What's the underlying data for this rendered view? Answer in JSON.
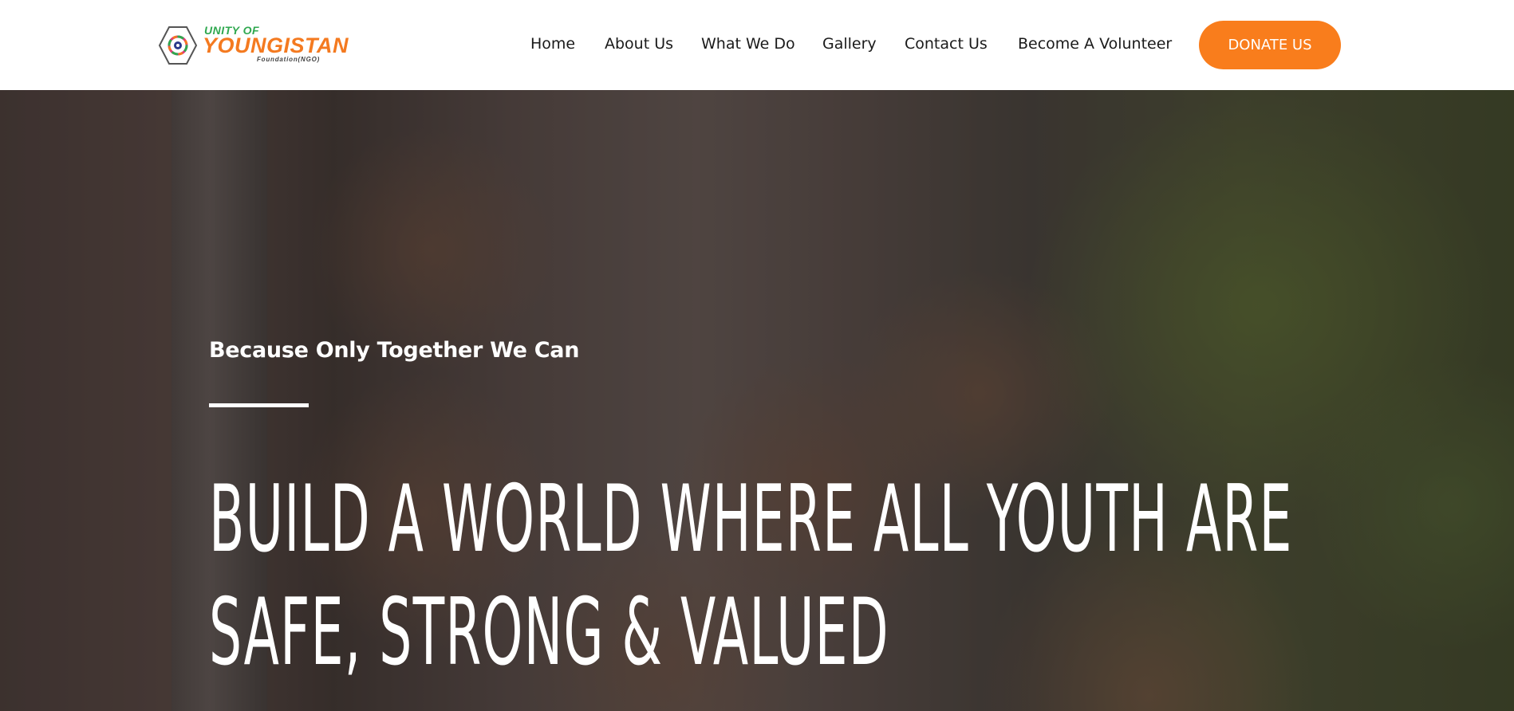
{
  "header": {
    "logo": {
      "top_text": "UNITY OF",
      "main_text": "YOUNGISTAN",
      "sub_text": "Foundation(NGO)"
    },
    "nav": [
      {
        "label": "Home"
      },
      {
        "label": "About Us"
      },
      {
        "label": "What We Do"
      },
      {
        "label": "Gallery"
      },
      {
        "label": "Contact Us"
      },
      {
        "label": "Become A Volunteer"
      }
    ],
    "donate_label": "DONATE US"
  },
  "hero": {
    "tagline": "Because Only Together We Can",
    "headline_line1": "BUILD A WORLD WHERE ALL YOUTH ARE",
    "headline_line2": "SAFE, STRONG & VALUED"
  },
  "colors": {
    "accent": "#f97d1c",
    "logo_green": "#2fa84f",
    "logo_orange": "#f47a20",
    "nav_text": "#1a1a1a"
  }
}
